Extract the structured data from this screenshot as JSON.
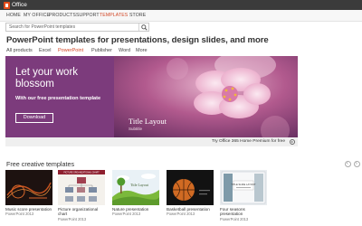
{
  "app": {
    "name": "Office"
  },
  "nav": {
    "items": [
      {
        "label": "HOME",
        "active": false
      },
      {
        "label": "MY OFFICE",
        "active": false
      },
      {
        "label": "PRODUCTS",
        "active": false
      },
      {
        "label": "SUPPORT",
        "active": false
      },
      {
        "label": "TEMPLATES",
        "active": true
      },
      {
        "label": "STORE",
        "active": false
      }
    ]
  },
  "search": {
    "placeholder": "Search for PowerPoint templates"
  },
  "page": {
    "title": "PowerPoint templates for presentations, design slides, and more"
  },
  "tabs": [
    {
      "label": "All products",
      "active": false
    },
    {
      "label": "Excel",
      "active": false
    },
    {
      "label": "PowerPoint",
      "active": true
    },
    {
      "label": "Publisher",
      "active": false
    },
    {
      "label": "Word",
      "active": false
    },
    {
      "label": "More",
      "active": false
    }
  ],
  "hero": {
    "heading_line1": "Let your work",
    "heading_line2": "blossom",
    "subtext": "With our free presentation template",
    "button": "Download",
    "slide_title": "Title Layout",
    "slide_subtitle": "Subtitle"
  },
  "premium": {
    "text": "Try Office 365 Home Premium for free"
  },
  "section": {
    "title": "Free creative templates"
  },
  "templates": [
    {
      "label": "Music score presentation",
      "sub": "PowerPoint 2013"
    },
    {
      "label": "Picture organizational chart",
      "sub": "PowerPoint 2013"
    },
    {
      "label": "Nature presentation",
      "sub": "PowerPoint 2013"
    },
    {
      "label": "Basketball presentation",
      "sub": "PowerPoint 2013"
    },
    {
      "label": "Four seasons presentation",
      "sub": "PowerPoint 2013"
    }
  ],
  "thumb_text": {
    "org_chart_header": "PICTURE ORGANIZATIONAL CHART",
    "nature_title": "Title Layout",
    "seasons_title": "TITLE SLIDE LAYOUT"
  },
  "colors": {
    "accent": "#d24726",
    "hero_purple": "#7c3b7c",
    "topbar": "#3b3b3b",
    "logo": "#e44c1a"
  },
  "icons": {
    "search": "search-icon",
    "premium": "arrow-circle-icon",
    "prev": "chevron-left-icon",
    "next": "chevron-right-icon"
  }
}
